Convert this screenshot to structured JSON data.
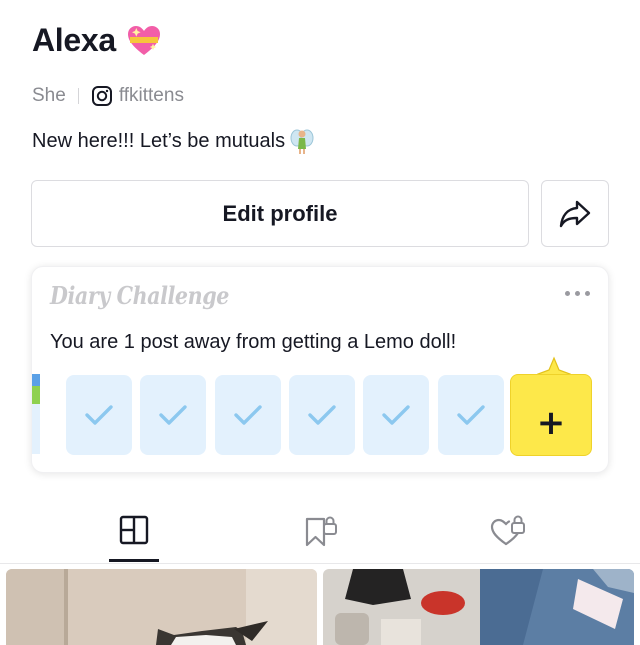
{
  "profile": {
    "name": "Alexa",
    "pronouns": "She",
    "instagram_handle": "ffkittens",
    "bio": "New here!!! Let’s be mutuals"
  },
  "actions": {
    "edit_profile_label": "Edit profile"
  },
  "diary_card": {
    "logo_text": "Diary Challenge",
    "message": "You are 1 post away from getting a Lemo doll!",
    "completed_days": 7,
    "colors": {
      "slot_bg": "#e3f1fd",
      "check": "#8cc8ef",
      "add_bg": "#fde84a"
    }
  },
  "tabs": [
    "grid-tab",
    "saved-locked-tab",
    "liked-locked-tab"
  ],
  "icons": [
    "sparkle-heart-icon",
    "instagram-icon",
    "fairy-icon",
    "share-arrow-icon",
    "more-dots-icon",
    "checkmark-icon",
    "plus-icon",
    "lemo-doll-icon",
    "grid-icon",
    "bookmark-lock-icon",
    "heart-lock-icon"
  ]
}
